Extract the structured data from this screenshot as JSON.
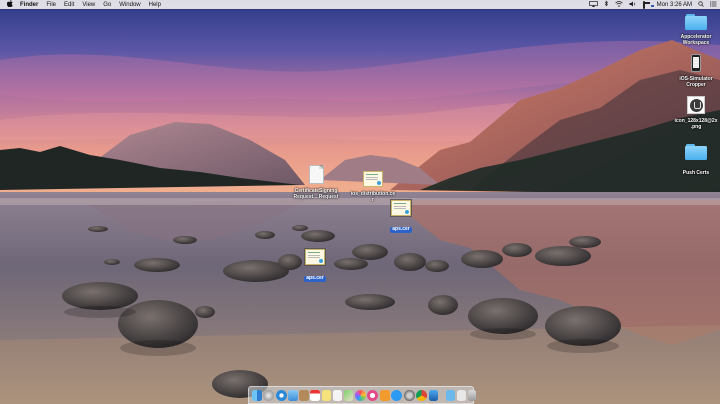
{
  "menubar": {
    "apple": "",
    "menus": [
      "Finder",
      "File",
      "Edit",
      "View",
      "Go",
      "Window",
      "Help"
    ],
    "clock": "Mon 3:26 AM"
  },
  "desktop_right": [
    {
      "label1": "Appcelerator",
      "label2": "Workspace",
      "icon": "folder-icon"
    },
    {
      "label1": "iOS-Simulator",
      "label2": "Cropper",
      "icon": "phone-icon"
    },
    {
      "label1": "icon_128x128@2x",
      "label2": ".png",
      "icon": "png-file-icon"
    },
    {
      "label1": "Push Certs",
      "label2": "",
      "icon": "folder-icon"
    }
  ],
  "desktop_center": {
    "csr": {
      "label1": "CertificateSigning",
      "label2": "Request....Request"
    },
    "ios_dist": {
      "label1": "ios_distribution.ce",
      "label2": "r"
    },
    "aps_top": {
      "label": "aps.cer"
    },
    "aps_bottom": {
      "label": "aps.cer"
    }
  },
  "dock_apps": [
    "finder",
    "launchpad",
    "safari",
    "mail",
    "contacts",
    "calendar",
    "notes",
    "reminders",
    "maps",
    "photos",
    "itunes",
    "ibooks",
    "app-store",
    "system-preferences",
    "chrome",
    "xcode",
    "downloads",
    "documents",
    "trash"
  ],
  "colors": {
    "selection": "#2d62c9",
    "menubar": "#eeecee"
  }
}
